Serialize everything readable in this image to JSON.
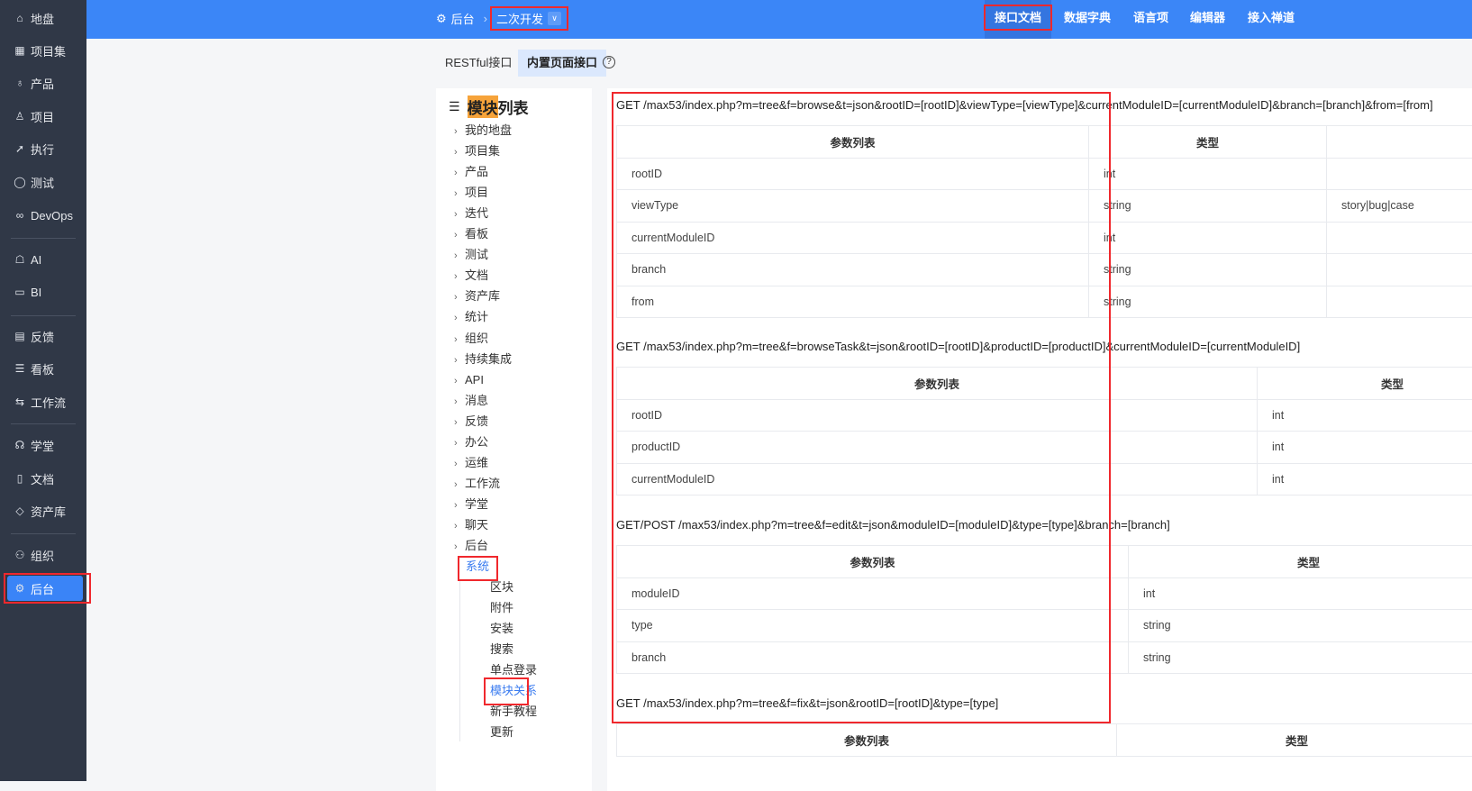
{
  "sidebar": {
    "items": [
      {
        "label": "地盘",
        "icon": "home-icon"
      },
      {
        "label": "项目集",
        "icon": "grid-icon"
      },
      {
        "label": "产品",
        "icon": "lightbulb-icon"
      },
      {
        "label": "项目",
        "icon": "rocket-icon"
      },
      {
        "label": "执行",
        "icon": "run-icon"
      },
      {
        "label": "测试",
        "icon": "search-bug-icon"
      },
      {
        "label": "DevOps",
        "icon": "infinity-icon"
      },
      {
        "label": "AI",
        "icon": "robot-icon"
      },
      {
        "label": "BI",
        "icon": "chart-board-icon"
      },
      {
        "label": "反馈",
        "icon": "feedback-icon"
      },
      {
        "label": "看板",
        "icon": "kanban-icon"
      },
      {
        "label": "工作流",
        "icon": "workflow-icon"
      },
      {
        "label": "学堂",
        "icon": "school-icon"
      },
      {
        "label": "文档",
        "icon": "document-icon"
      },
      {
        "label": "资产库",
        "icon": "diamond-icon"
      },
      {
        "label": "组织",
        "icon": "users-icon"
      },
      {
        "label": "后台",
        "icon": "gear-icon"
      }
    ]
  },
  "header": {
    "crumb_root": "后台",
    "crumb_current": "二次开发",
    "nav": [
      "接口文档",
      "数据字典",
      "语言项",
      "编辑器",
      "接入禅道"
    ]
  },
  "subtabs": [
    "RESTful接口",
    "内置页面接口"
  ],
  "tree": {
    "title_hl": "模块",
    "title_rest": "列表",
    "items": [
      "我的地盘",
      "项目集",
      "产品",
      "项目",
      "迭代",
      "看板",
      "测试",
      "文档",
      "资产库",
      "统计",
      "组织",
      "持续集成",
      "API",
      "消息",
      "反馈",
      "办公",
      "运维",
      "工作流",
      "学堂",
      "聊天",
      "后台"
    ],
    "expanded": "系统",
    "children": [
      "区块",
      "附件",
      "安装",
      "搜索",
      "单点登录",
      "模块关系",
      "新手教程",
      "更新"
    ],
    "active_child": "模块关系"
  },
  "apis": [
    {
      "sig": "GET /max53/index.php?m=tree&f=browse&t=json&rootID=[rootID]&viewType=[viewType]&currentModuleID=[currentModuleID]&branch=[branch]&from=[from]",
      "headers": [
        "参数列表",
        "类型",
        ""
      ],
      "rows": [
        [
          "rootID",
          "int",
          ""
        ],
        [
          "viewType",
          "string",
          "story|bug|case"
        ],
        [
          "currentModuleID",
          "int",
          ""
        ],
        [
          "branch",
          "string",
          ""
        ],
        [
          "from",
          "string",
          ""
        ]
      ]
    },
    {
      "sig": "GET /max53/index.php?m=tree&f=browseTask&t=json&rootID=[rootID]&productID=[productID]&currentModuleID=[currentModuleID]",
      "headers": [
        "参数列表",
        "类型"
      ],
      "rows": [
        [
          "rootID",
          "int"
        ],
        [
          "productID",
          "int"
        ],
        [
          "currentModuleID",
          "int"
        ]
      ]
    },
    {
      "sig": "GET/POST /max53/index.php?m=tree&f=edit&t=json&moduleID=[moduleID]&type=[type]&branch=[branch]",
      "headers": [
        "参数列表",
        "类型"
      ],
      "rows": [
        [
          "moduleID",
          "int"
        ],
        [
          "type",
          "string"
        ],
        [
          "branch",
          "string"
        ]
      ]
    },
    {
      "sig": "GET /max53/index.php?m=tree&f=fix&t=json&rootID=[rootID]&type=[type]",
      "headers": [
        "参数列表",
        "类型"
      ],
      "rows": []
    }
  ]
}
